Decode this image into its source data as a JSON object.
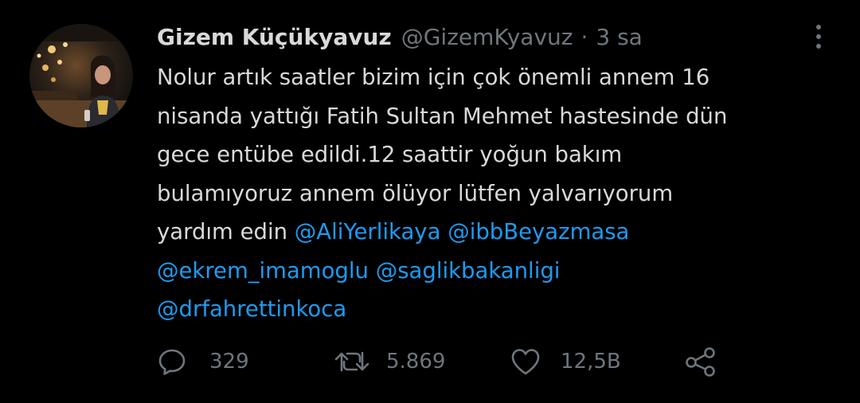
{
  "tweet": {
    "author": {
      "display_name": "Gizem Küçükyavuz",
      "handle": "@GizemKyavuz",
      "separator": "·",
      "time": "3 sa",
      "avatar_icon": "avatar-photo"
    },
    "text_lines": [
      [
        {
          "text": "Nolur artık saatler bizim için çok önemli annem 16"
        }
      ],
      [
        {
          "text": "nisanda yattığı Fatih Sultan Mehmet hastesinde dün"
        }
      ],
      [
        {
          "text": "gece entübe edildi.12 saattir yoğun bakım"
        }
      ],
      [
        {
          "text": "bulamıyoruz annem ölüyor lütfen yalvarıyorum"
        }
      ],
      [
        {
          "text": "yardım edin "
        },
        {
          "text": "@AliYerlikaya",
          "mention": true
        },
        {
          "text": " "
        },
        {
          "text": "@ibbBeyazmasa",
          "mention": true
        }
      ],
      [
        {
          "text": "@ekrem_imamoglu",
          "mention": true
        },
        {
          "text": " "
        },
        {
          "text": "@saglikbakanligi",
          "mention": true
        }
      ],
      [
        {
          "text": "@drfahrettinkoca",
          "mention": true
        }
      ]
    ],
    "actions": {
      "reply": {
        "icon": "reply-icon",
        "count": "329"
      },
      "retweet": {
        "icon": "retweet-icon",
        "count": "5.869"
      },
      "like": {
        "icon": "like-icon",
        "count": "12,5B"
      },
      "share": {
        "icon": "share-icon"
      }
    },
    "more_icon": "more-vertical-icon"
  },
  "colors": {
    "background": "#000000",
    "text": "#d9d9d9",
    "secondary": "#6e767d",
    "mention": "#1d9bf0"
  }
}
